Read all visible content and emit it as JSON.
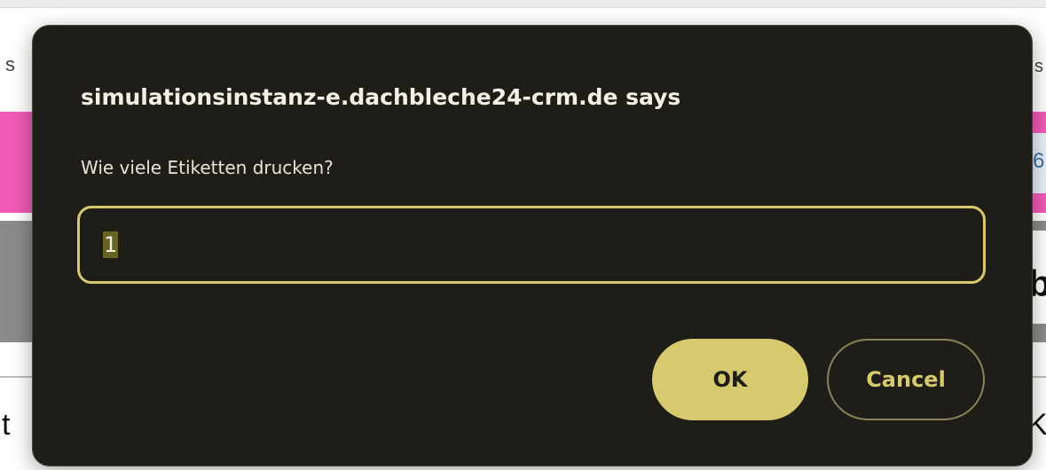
{
  "background": {
    "left_top_fragment": "s",
    "right_top_fragment": "s",
    "right_panel_fragment": "6",
    "right_gray_fragment": "b",
    "left_bottom_fragment": "t",
    "right_bottom_fragment": "K"
  },
  "dialog": {
    "title": "simulationsinstanz-e.dachbleche24-crm.de says",
    "message": "Wie viele Etiketten drucken?",
    "input_value": "1",
    "ok_label": "OK",
    "cancel_label": "Cancel"
  },
  "colors": {
    "dialog_background": "#1f1d17",
    "accent": "#d7c96d",
    "pink_band": "#f25bb7",
    "gray_bar": "#8b8b8b"
  }
}
